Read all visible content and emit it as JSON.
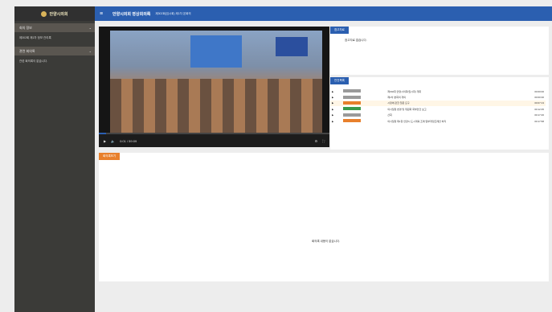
{
  "brand": {
    "name": "안양시의회"
  },
  "sidebar": {
    "sections": [
      {
        "header": "회의 정보",
        "item": "제302회 제1차 정보 관리록"
      },
      {
        "header": "관련 회의록",
        "item": "관련 회의록이 없습니다."
      }
    ]
  },
  "topbar": {
    "title": "안양시의회 영상회의록",
    "subtitle": "제302회(임시회) 제1차 본회의"
  },
  "video": {
    "time": "0:01 / 59:09",
    "progress": 0.03
  },
  "materials": {
    "tab": "참고자료",
    "message": "참고자료 없습니다."
  },
  "order": {
    "tab": "안건목록",
    "rows": [
      {
        "label": "제302회 안양시의회(임시회) 개회",
        "time": "00:00:00",
        "badge": "gray"
      },
      {
        "label": "제1차 본회의 개의",
        "time": "00:00:30",
        "badge": "gray"
      },
      {
        "label": "시정에 관한 질문 요구",
        "time": "00:07:13",
        "badge": "orange"
      },
      {
        "label": "의사일정 변경 및 위원회 회부안건 보고",
        "time": "00:12:35",
        "badge": "green"
      },
      {
        "label": "산회",
        "time": "00:17:46",
        "badge": "gray"
      },
      {
        "label": "의사일정 제1항 안양시 도시계획 조례 일부개정조례안 처리",
        "time": "00:17:58",
        "badge": "orange"
      }
    ]
  },
  "log": {
    "tab": "회의록보기",
    "message": "회의록 내용이 없습니다."
  }
}
